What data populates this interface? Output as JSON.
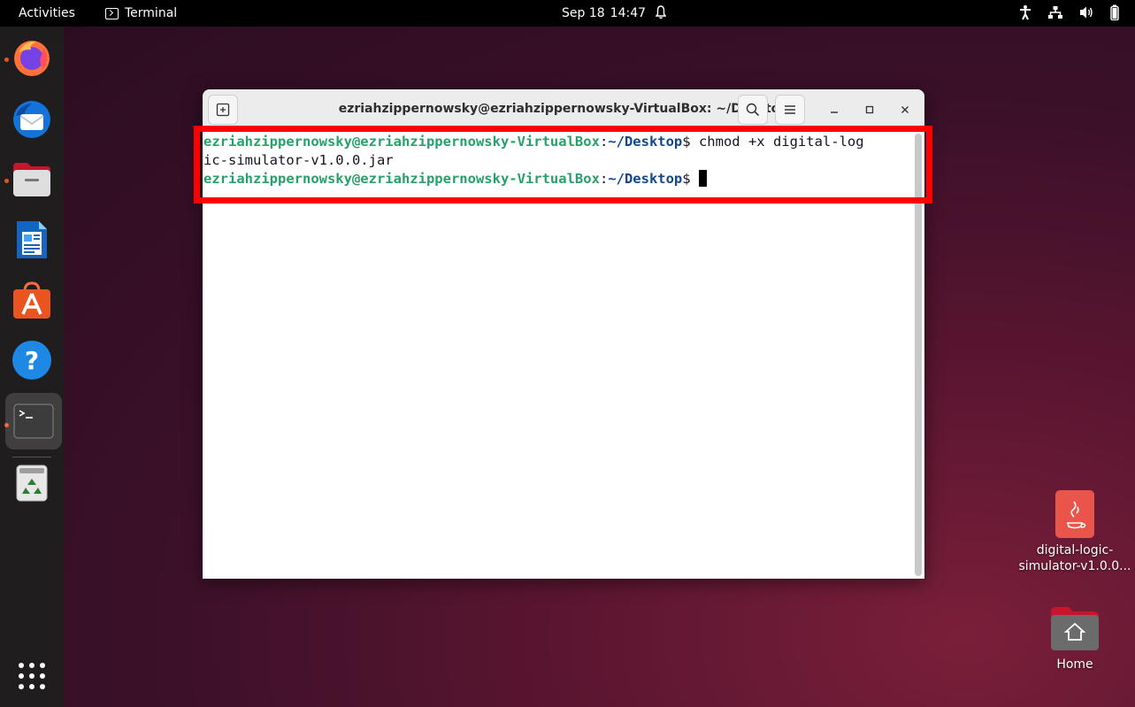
{
  "topbar": {
    "activities": "Activities",
    "app_name": "Terminal",
    "date": "Sep 18",
    "time": "14:47"
  },
  "dock": {
    "items": [
      "firefox",
      "thunderbird",
      "files",
      "libreoffice-writer",
      "app-center",
      "help",
      "terminal",
      "trash",
      "show-apps"
    ]
  },
  "window": {
    "title": "ezriahzippernowsky@ezriahzippernowsky-VirtualBox: ~/Desktop",
    "lines": [
      {
        "user": "ezriahzippernowsky@ezriahzippernowsky-VirtualBox",
        "sep": ":",
        "path": "~/Desktop",
        "prompt": "$ ",
        "cmd": "chmod +x digital-log"
      },
      {
        "text": "ic-simulator-v1.0.0.jar"
      },
      {
        "user": "ezriahzippernowsky@ezriahzippernowsky-VirtualBox",
        "sep": ":",
        "path": "~/Desktop",
        "prompt": "$ ",
        "cmd": ""
      }
    ]
  },
  "desktop": {
    "jar_label_1": "digital-logic-",
    "jar_label_2": "simulator-v1.0.0...",
    "home_label": "Home"
  },
  "colors": {
    "accent": "#e95420",
    "user_green": "#26a269",
    "path_blue": "#12488b",
    "highlight": "#ff0000"
  }
}
